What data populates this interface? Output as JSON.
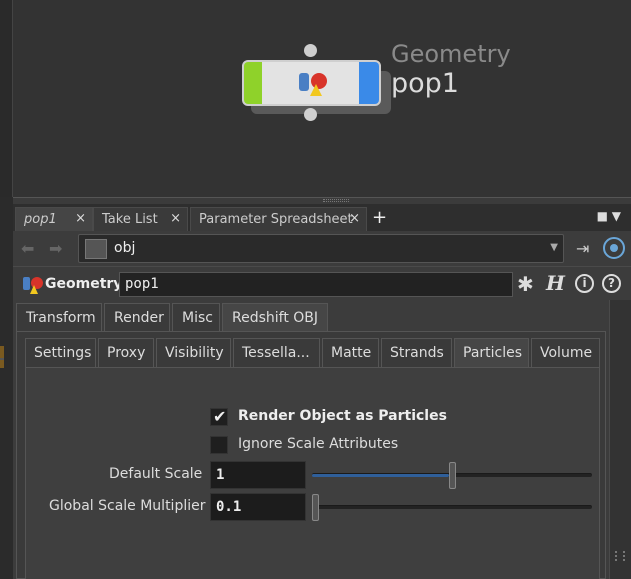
{
  "network": {
    "node": {
      "type_label": "Geometry",
      "name": "pop1",
      "left_flag_color": "#8fd22a",
      "right_flag_color": "#3a8ae8"
    }
  },
  "pane_tabs": [
    {
      "label": "pop1",
      "active": true
    },
    {
      "label": "Take List",
      "active": false
    },
    {
      "label": "Parameter Spreadsheet",
      "active": false
    }
  ],
  "icons": {
    "close": "×",
    "add": "+",
    "back": "⬅",
    "forward": "➡",
    "dropdown": "▼",
    "pane_menu": "■ ▼",
    "pin": "⇥",
    "gear": "✱",
    "help_h": "H",
    "info": "i",
    "help": "?",
    "check": "✔"
  },
  "path_bar": {
    "path": "obj"
  },
  "param_header": {
    "node_type": "Geometry",
    "node_name": "pop1"
  },
  "main_tabs": [
    {
      "label": "Transform",
      "active": false
    },
    {
      "label": "Render",
      "active": false
    },
    {
      "label": "Misc",
      "active": false
    },
    {
      "label": "Redshift OBJ",
      "active": true
    }
  ],
  "sub_tabs": [
    {
      "label": "Settings",
      "active": false
    },
    {
      "label": "Proxy",
      "active": false
    },
    {
      "label": "Visibility",
      "active": false
    },
    {
      "label": "Tessella...",
      "active": false
    },
    {
      "label": "Matte",
      "active": false
    },
    {
      "label": "Strands",
      "active": false
    },
    {
      "label": "Particles",
      "active": true
    },
    {
      "label": "Volume",
      "active": false
    }
  ],
  "particles": {
    "render_as_particles": {
      "label": "Render Object as Particles",
      "checked": true
    },
    "ignore_scale": {
      "label": "Ignore Scale Attributes",
      "checked": false
    },
    "default_scale": {
      "label": "Default Scale",
      "value": "1",
      "slider_fraction": 0.5
    },
    "global_scale_multiplier": {
      "label": "Global Scale Multiplier",
      "value": "0.1",
      "slider_fraction": 0.0
    }
  }
}
